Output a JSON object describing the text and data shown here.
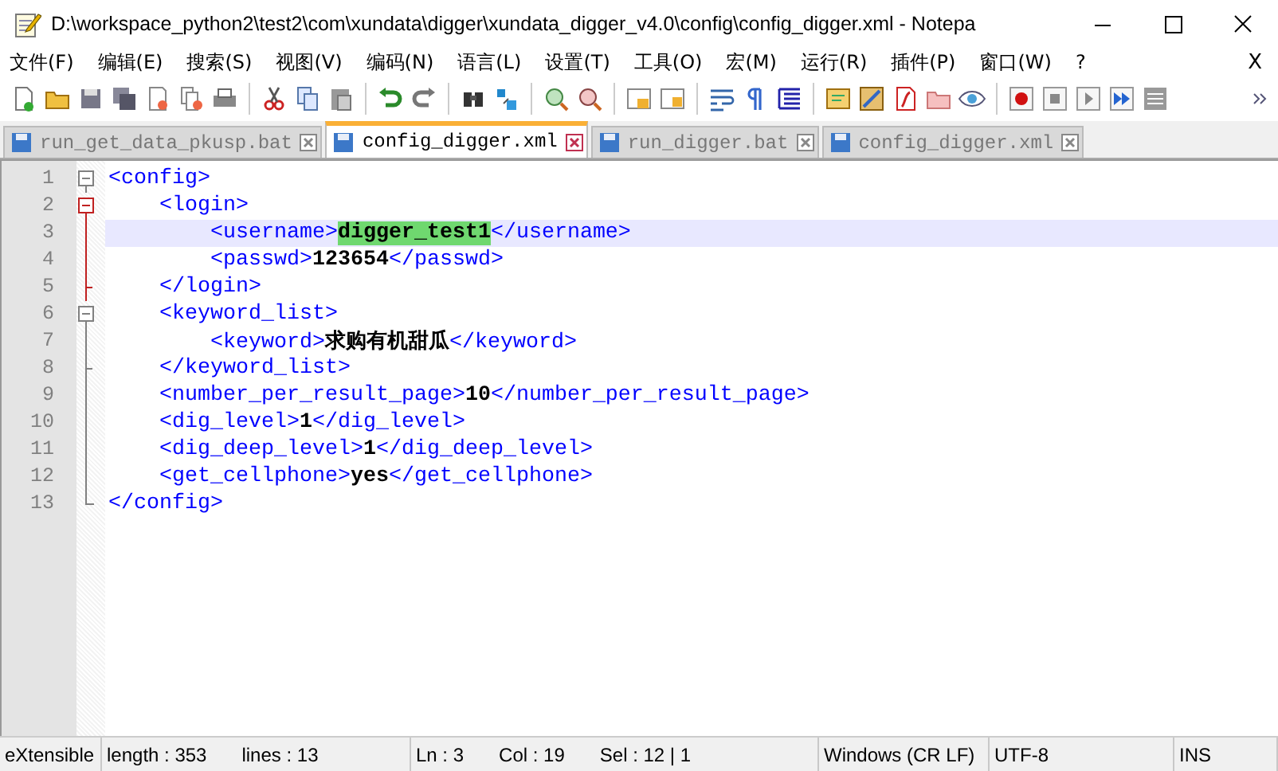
{
  "window": {
    "title": "D:\\workspace_python2\\test2\\com\\xundata\\digger\\xundata_digger_v4.0\\config\\config_digger.xml - Notepa"
  },
  "menu": {
    "items": [
      "文件(F)",
      "编辑(E)",
      "搜索(S)",
      "视图(V)",
      "编码(N)",
      "语言(L)",
      "设置(T)",
      "工具(O)",
      "宏(M)",
      "运行(R)",
      "插件(P)",
      "窗口(W)",
      "?"
    ],
    "close": "X"
  },
  "tabs": [
    {
      "label": "run_get_data_pkusp.bat",
      "selected": false
    },
    {
      "label": "config_digger.xml",
      "selected": true
    },
    {
      "label": "run_digger.bat",
      "selected": false
    },
    {
      "label": "config_digger.xml",
      "selected": false
    }
  ],
  "editor": {
    "lines": [
      {
        "number": "1",
        "kind": "box",
        "in_current_block": false,
        "current": false,
        "tokens": [
          {
            "kind": "tag",
            "text": "<config>"
          }
        ]
      },
      {
        "number": "2",
        "kind": "box",
        "in_current_block": true,
        "current": false,
        "tokens": [
          {
            "kind": "tag",
            "text": "    <login>"
          }
        ]
      },
      {
        "number": "3",
        "kind": "line",
        "in_current_block": true,
        "current": true,
        "tokens": [
          {
            "kind": "tag",
            "text": "        <username>"
          },
          {
            "kind": "text",
            "text": "digger_test1",
            "highlighted": true
          },
          {
            "kind": "tag",
            "text": "</username>"
          }
        ]
      },
      {
        "number": "4",
        "kind": "line",
        "in_current_block": true,
        "current": false,
        "tokens": [
          {
            "kind": "tag",
            "text": "        <passwd>"
          },
          {
            "kind": "text",
            "text": "123654"
          },
          {
            "kind": "tag",
            "text": "</passwd>"
          }
        ]
      },
      {
        "number": "5",
        "kind": "end",
        "in_current_block": true,
        "current": false,
        "tokens": [
          {
            "kind": "tag",
            "text": "    </login>"
          }
        ]
      },
      {
        "number": "6",
        "kind": "box",
        "in_current_block": false,
        "current": false,
        "tokens": [
          {
            "kind": "tag",
            "text": "    <keyword_list>"
          }
        ]
      },
      {
        "number": "7",
        "kind": "line",
        "in_current_block": false,
        "current": false,
        "tokens": [
          {
            "kind": "tag",
            "text": "        <keyword>"
          },
          {
            "kind": "text",
            "text": "求购有机甜瓜"
          },
          {
            "kind": "tag",
            "text": "</keyword>"
          }
        ]
      },
      {
        "number": "8",
        "kind": "end",
        "in_current_block": false,
        "current": false,
        "tokens": [
          {
            "kind": "tag",
            "text": "    </keyword_list>"
          }
        ]
      },
      {
        "number": "9",
        "kind": "line",
        "in_current_block": false,
        "current": false,
        "tokens": [
          {
            "kind": "tag",
            "text": "    <number_per_result_page>"
          },
          {
            "kind": "text",
            "text": "10"
          },
          {
            "kind": "tag",
            "text": "</number_per_result_page>"
          }
        ]
      },
      {
        "number": "10",
        "kind": "line",
        "in_current_block": false,
        "current": false,
        "tokens": [
          {
            "kind": "tag",
            "text": "    <dig_level>"
          },
          {
            "kind": "text",
            "text": "1"
          },
          {
            "kind": "tag",
            "text": "</dig_level>"
          }
        ]
      },
      {
        "number": "11",
        "kind": "line",
        "in_current_block": false,
        "current": false,
        "tokens": [
          {
            "kind": "tag",
            "text": "    <dig_deep_level>"
          },
          {
            "kind": "text",
            "text": "1"
          },
          {
            "kind": "tag",
            "text": "</dig_deep_level>"
          }
        ]
      },
      {
        "number": "12",
        "kind": "line",
        "in_current_block": false,
        "current": false,
        "tokens": [
          {
            "kind": "tag",
            "text": "    <get_cellphone>"
          },
          {
            "kind": "text",
            "text": "yes"
          },
          {
            "kind": "tag",
            "text": "</get_cellphone>"
          }
        ]
      },
      {
        "number": "13",
        "kind": "last",
        "in_current_block": false,
        "current": false,
        "tokens": [
          {
            "kind": "tag",
            "text": "</config>"
          }
        ]
      }
    ]
  },
  "status_bar": {
    "file_type": "eXtensible",
    "length": "length : 353",
    "lines": "lines : 13",
    "ln": "Ln : 3",
    "col": "Col : 19",
    "sel": "Sel : 12 | 1",
    "eol": "Windows (CR LF)",
    "encoding": "UTF-8",
    "mode": "INS"
  }
}
